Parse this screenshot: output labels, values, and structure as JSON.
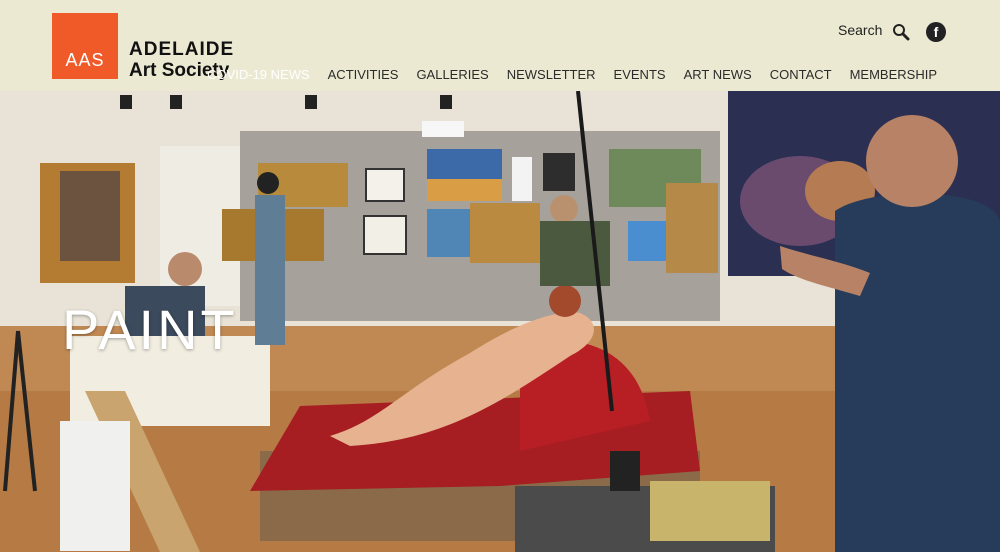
{
  "header": {
    "logo": {
      "mark": "AAS",
      "line1": "ADELAIDE",
      "line2": "Art Society",
      "color": "#f05a28"
    },
    "search_label": "Search",
    "search_icon": "magnifier-icon",
    "social_icon": "facebook-icon",
    "facebook_glyph": "f"
  },
  "nav": {
    "items": [
      {
        "label": "COVID-19 NEWS",
        "active": true
      },
      {
        "label": "ACTIVITIES",
        "active": false
      },
      {
        "label": "GALLERIES",
        "active": false
      },
      {
        "label": "NEWSLETTER",
        "active": false
      },
      {
        "label": "EVENTS",
        "active": false
      },
      {
        "label": "ART NEWS",
        "active": false
      },
      {
        "label": "CONTACT",
        "active": false
      },
      {
        "label": "MEMBERSHIP",
        "active": false
      }
    ]
  },
  "hero": {
    "title": "PAINT",
    "image_description": "life drawing session in a gallery studio"
  },
  "colors": {
    "header_bg": "#ece9d3",
    "accent": "#f05a28",
    "nav_active": "#ffffff"
  }
}
